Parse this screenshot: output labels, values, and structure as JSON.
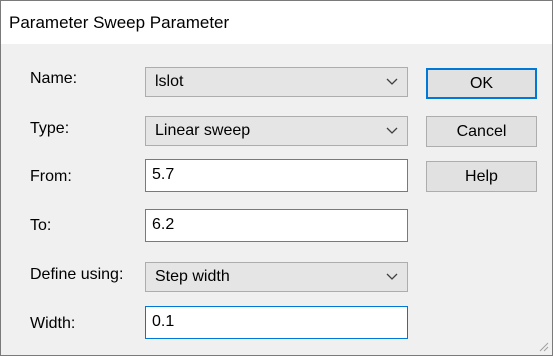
{
  "dialog": {
    "title": "Parameter Sweep Parameter"
  },
  "fields": {
    "name": {
      "label": "Name:",
      "value": "lslot"
    },
    "type": {
      "label": "Type:",
      "value": "Linear sweep"
    },
    "from": {
      "label": "From:",
      "value": "5.7"
    },
    "to": {
      "label": "To:",
      "value": "6.2"
    },
    "define_using": {
      "label": "Define using:",
      "value": "Step width"
    },
    "width": {
      "label": "Width:",
      "value": "0.1"
    }
  },
  "buttons": {
    "ok": "OK",
    "cancel": "Cancel",
    "help": "Help"
  },
  "icons": {
    "dropdown": "chevron-down-icon",
    "grip": "resize-grip-icon"
  },
  "colors": {
    "focus_accent": "#0078d7",
    "dialog_bg": "#f0f0f0"
  }
}
